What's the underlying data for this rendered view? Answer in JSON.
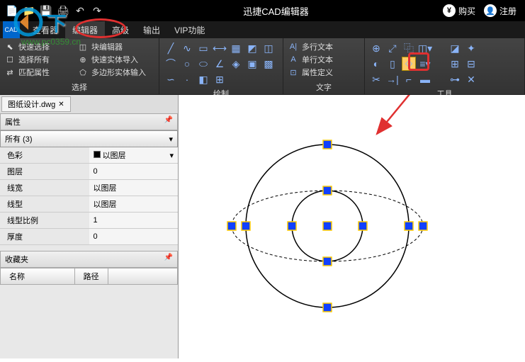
{
  "titlebar": {
    "app_title": "迅捷CAD编辑器",
    "buy": "购买",
    "register": "注册"
  },
  "menubar": {
    "items": [
      "查看器",
      "编辑器",
      "高级",
      "输出",
      "VIP功能"
    ],
    "cad_badge": "CAD"
  },
  "watermark": {
    "url": "www.pc0359.cn"
  },
  "ribbon": {
    "groups": {
      "select": {
        "label": "选择",
        "quick_select": "快速选择",
        "block_editor": "块编辑器",
        "select_all": "选择所有",
        "quick_import": "快速实体导入",
        "match_props": "匹配属性",
        "poly_input": "多边形实体输入"
      },
      "draw": {
        "label": "绘制"
      },
      "text": {
        "label": "文字",
        "multiline": "多行文本",
        "singleline": "单行文本",
        "attr_def": "属性定义"
      },
      "tools": {
        "label": "工具"
      }
    }
  },
  "file_tab": {
    "filename": "图纸设计.dwg"
  },
  "panels": {
    "properties": {
      "title": "属性",
      "filter": "所有 (3)",
      "rows": [
        {
          "name": "色彩",
          "value": "以图层",
          "has_swatch": true,
          "has_dropdown": true
        },
        {
          "name": "图层",
          "value": "0"
        },
        {
          "name": "线宽",
          "value": "以图层"
        },
        {
          "name": "线型",
          "value": "以图层"
        },
        {
          "name": "线型比例",
          "value": "1"
        },
        {
          "name": "厚度",
          "value": "0"
        }
      ]
    },
    "favorites": {
      "title": "收藏夹",
      "col_name": "名称",
      "col_path": "路径"
    }
  },
  "colors": {
    "handle": "#1040ff",
    "handle_border": "#ffcc00",
    "arrow": "#e03030"
  }
}
